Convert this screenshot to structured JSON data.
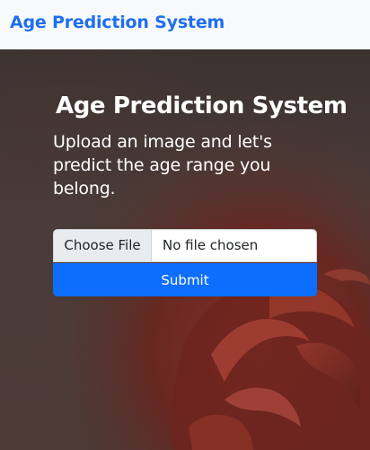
{
  "navbar": {
    "brand": "Age Prediction System"
  },
  "hero": {
    "title": "Age Prediction System",
    "subtitle": "Upload an image and let's predict the age range you belong."
  },
  "form": {
    "choose_file_label": "Choose File",
    "file_status": "No file chosen",
    "submit_label": "Submit"
  },
  "colors": {
    "brand": "#1f6fee",
    "primary_button": "#0d6efd",
    "navbar_bg": "#f8f9fa",
    "hero_bg": "#3f3532"
  }
}
